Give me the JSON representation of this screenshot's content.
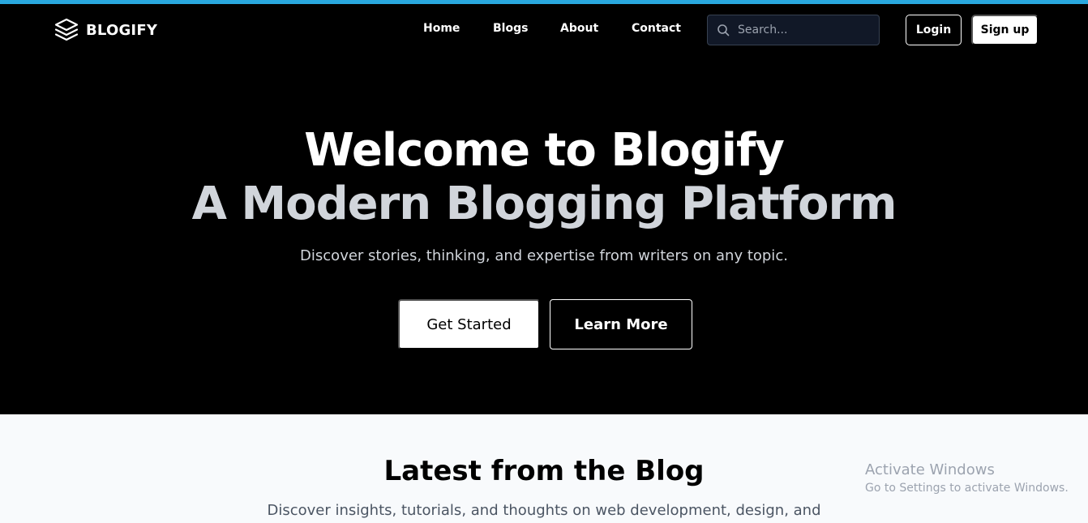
{
  "brand": {
    "name": "BLOGIFY",
    "icon": "layers-icon"
  },
  "nav": {
    "links": [
      {
        "label": "Home"
      },
      {
        "label": "Blogs"
      },
      {
        "label": "About"
      },
      {
        "label": "Contact"
      }
    ]
  },
  "search": {
    "placeholder": "Search...",
    "value": "",
    "icon": "search-icon"
  },
  "auth": {
    "login_label": "Login",
    "signup_label": "Sign up"
  },
  "hero": {
    "title_line1": "Welcome to Blogify",
    "title_line2": "A Modern Blogging Platform",
    "subtitle": "Discover stories, thinking, and expertise from writers on any topic.",
    "cta_primary": "Get Started",
    "cta_secondary": "Learn More"
  },
  "latest": {
    "title": "Latest from the Blog",
    "description": "Discover insights, tutorials, and thoughts on web development, design, and"
  },
  "watermark": {
    "title": "Activate Windows",
    "subtitle": "Go to Settings to activate Windows."
  },
  "colors": {
    "accent_strip": "#29a8df",
    "hero_bg": "#000000",
    "section_bg": "#f8fafc",
    "title_secondary": "#d1d5db"
  }
}
